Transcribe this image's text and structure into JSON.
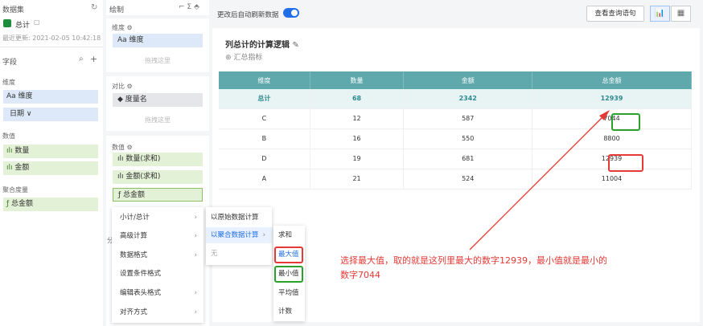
{
  "left": {
    "dataset_title": "数据集",
    "dataset_name": "总计",
    "last_update": "最近更新: 2021-02-05 10:42:18",
    "fields_title": "字段",
    "dimension_title": "维度",
    "dimension_fields": [
      "Aa 维度",
      "日期 ∨"
    ],
    "value_title": "数值",
    "value_fields": [
      "数量",
      "金额"
    ],
    "agg_title": "聚合度量",
    "agg_fields": [
      "总金额"
    ]
  },
  "middle": {
    "draw_title": "绘制",
    "dimension_label": "维度 ⚙",
    "dimension_chip": "Aa 维度",
    "drop_hint": "拖拽这里",
    "compare_label": "对比 ⚙",
    "compare_chip": "度量名",
    "value_label": "数值 ⚙",
    "value_chips": [
      "数量(求和)",
      "金额(求和)",
      "总金额"
    ],
    "partial_label": "分"
  },
  "toolbar": {
    "auto_refresh_label": "更改后自动刷新数据",
    "view_sql": "查看查询语句"
  },
  "report": {
    "title": "列总计的计算逻辑",
    "summary_link": "汇总指标"
  },
  "table": {
    "headers": [
      "维度",
      "数量",
      "金额",
      "总金额"
    ],
    "total_row": [
      "总计",
      "68",
      "2342",
      "12939"
    ],
    "rows": [
      [
        "C",
        "12",
        "587",
        "7044"
      ],
      [
        "B",
        "16",
        "550",
        "8800"
      ],
      [
        "D",
        "19",
        "681",
        "12939"
      ],
      [
        "A",
        "21",
        "524",
        "11004"
      ]
    ]
  },
  "menu1": [
    "小计/总计",
    "高级计算",
    "数据格式",
    "设置条件格式",
    "编辑表头格式",
    "对齐方式"
  ],
  "menu2": [
    "以原始数据计算",
    "以聚合数据计算",
    "无"
  ],
  "menu3": [
    "求和",
    "最大值",
    "最小值",
    "平均值",
    "计数"
  ],
  "annotation": {
    "line1": "选择最大值，取的就是这列里最大的数字12939，最小值就是最小的",
    "line2": "数字7044"
  },
  "colors": {
    "header_teal": "#5fa9ad",
    "accent_blue": "#1f6fe8",
    "annot_red": "#e53935",
    "annot_green": "#2aa12a"
  }
}
